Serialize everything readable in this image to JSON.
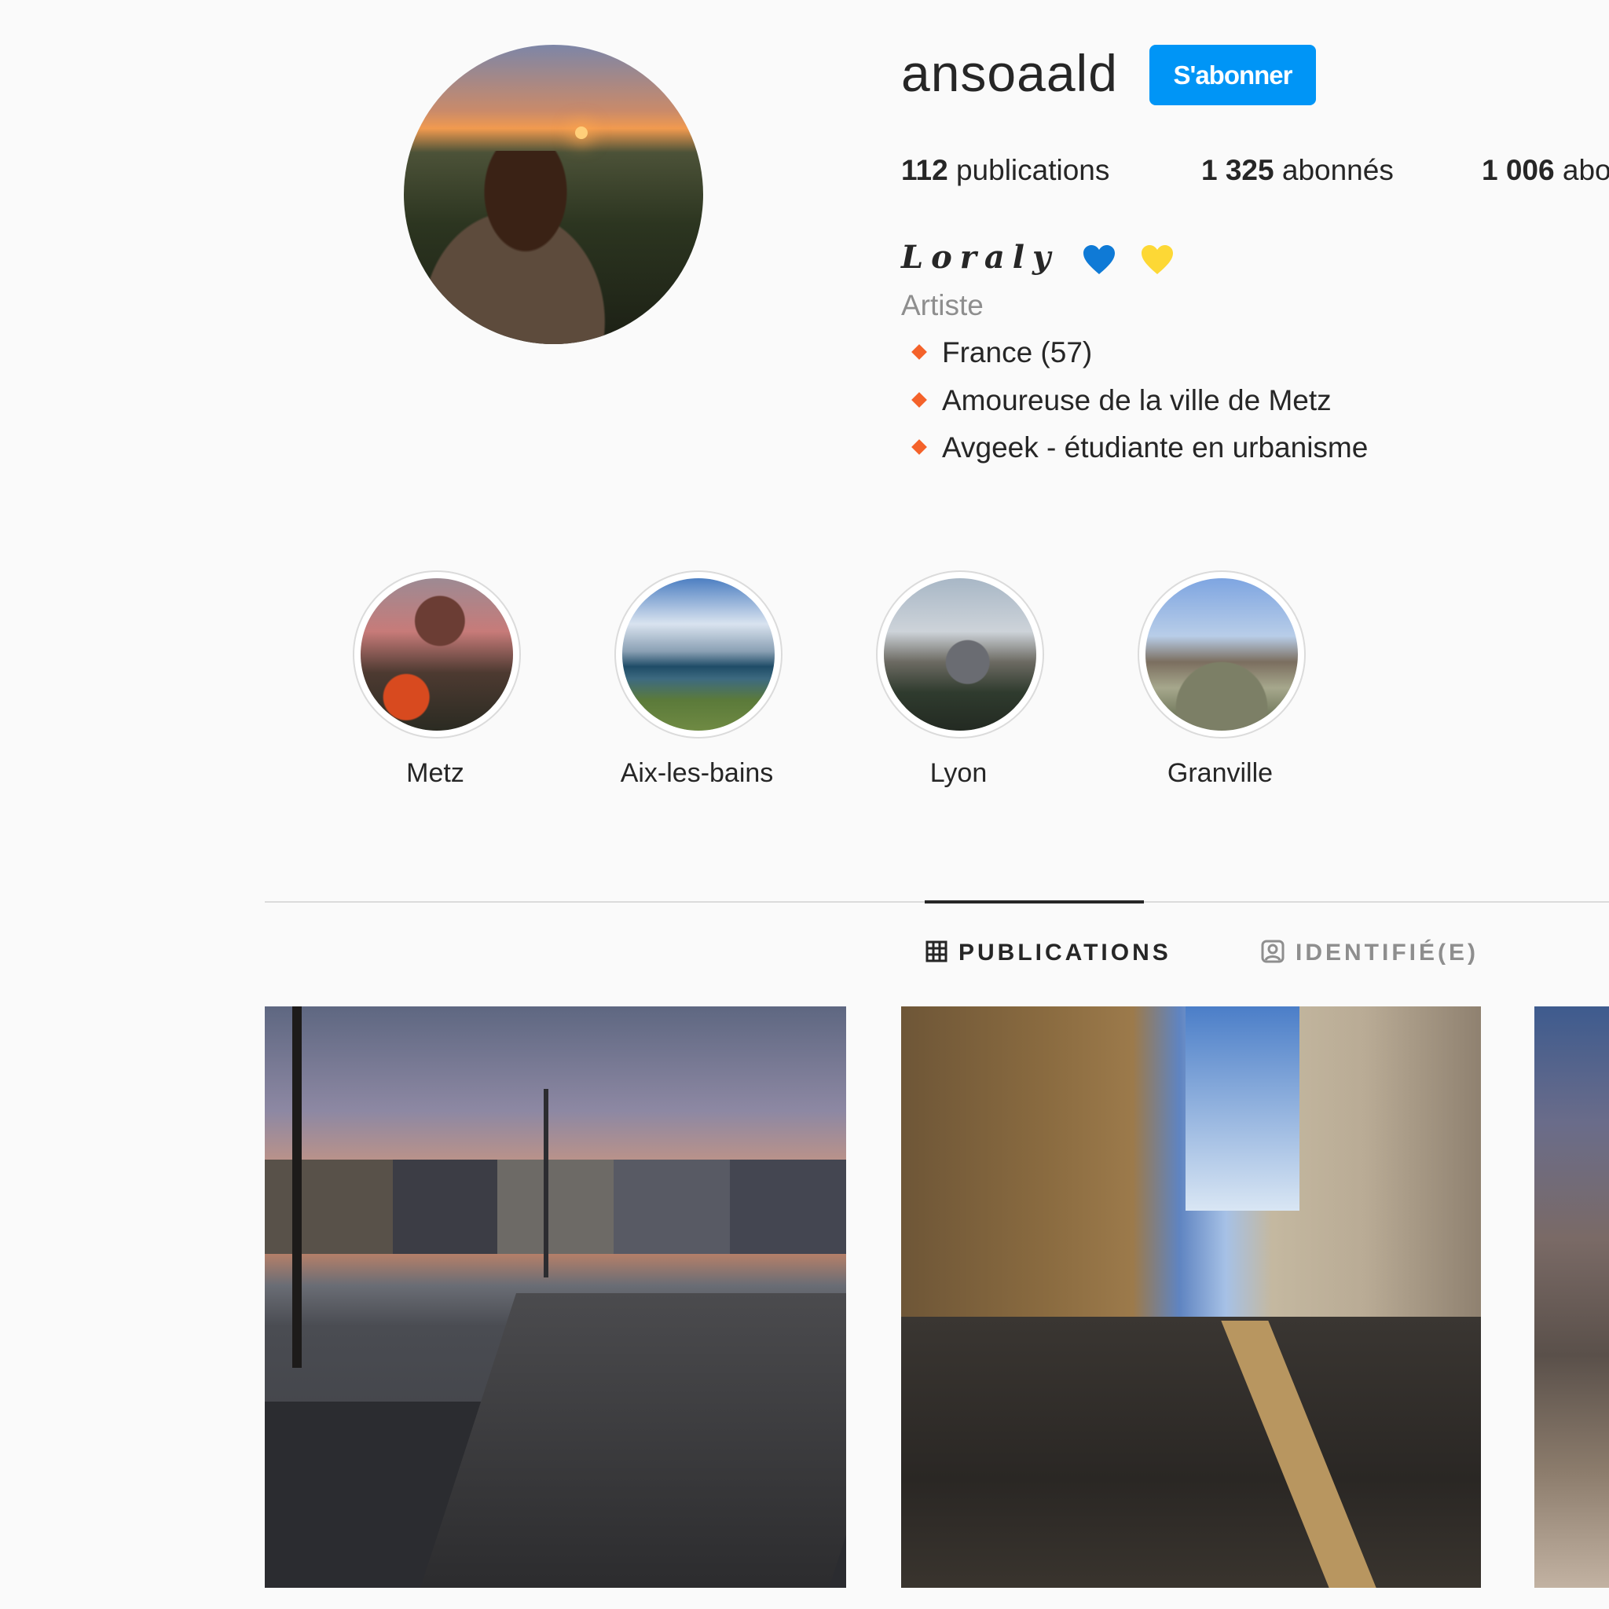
{
  "profile": {
    "username": "ansoaald",
    "follow_label": "S'abonner",
    "stats": {
      "posts_count": "112",
      "posts_label": " publications",
      "followers_count": "1 325",
      "followers_label": " abonnés",
      "following_count": "1 006",
      "following_label": " abo"
    },
    "full_name": "Loraly",
    "hearts": [
      "blue-heart-emoji",
      "yellow-heart-emoji"
    ],
    "category": "Artiste",
    "bio": [
      "France (57)",
      "Amoureuse de la ville de Metz",
      "Avgeek - étudiante en urbanisme"
    ],
    "bio_bullet_color": "#f4622a"
  },
  "highlights": [
    {
      "label": "Metz"
    },
    {
      "label": "Aix-les-bains"
    },
    {
      "label": "Lyon"
    },
    {
      "label": "Granville"
    }
  ],
  "tabs": [
    {
      "label": "PUBLICATIONS",
      "icon": "grid-icon",
      "active": true
    },
    {
      "label": "IDENTIFIÉ(E)",
      "icon": "tagged-user-icon",
      "active": false
    }
  ],
  "colors": {
    "accent": "#0095f6",
    "background": "#fafafa",
    "secondary_text": "#8e8e8e"
  }
}
